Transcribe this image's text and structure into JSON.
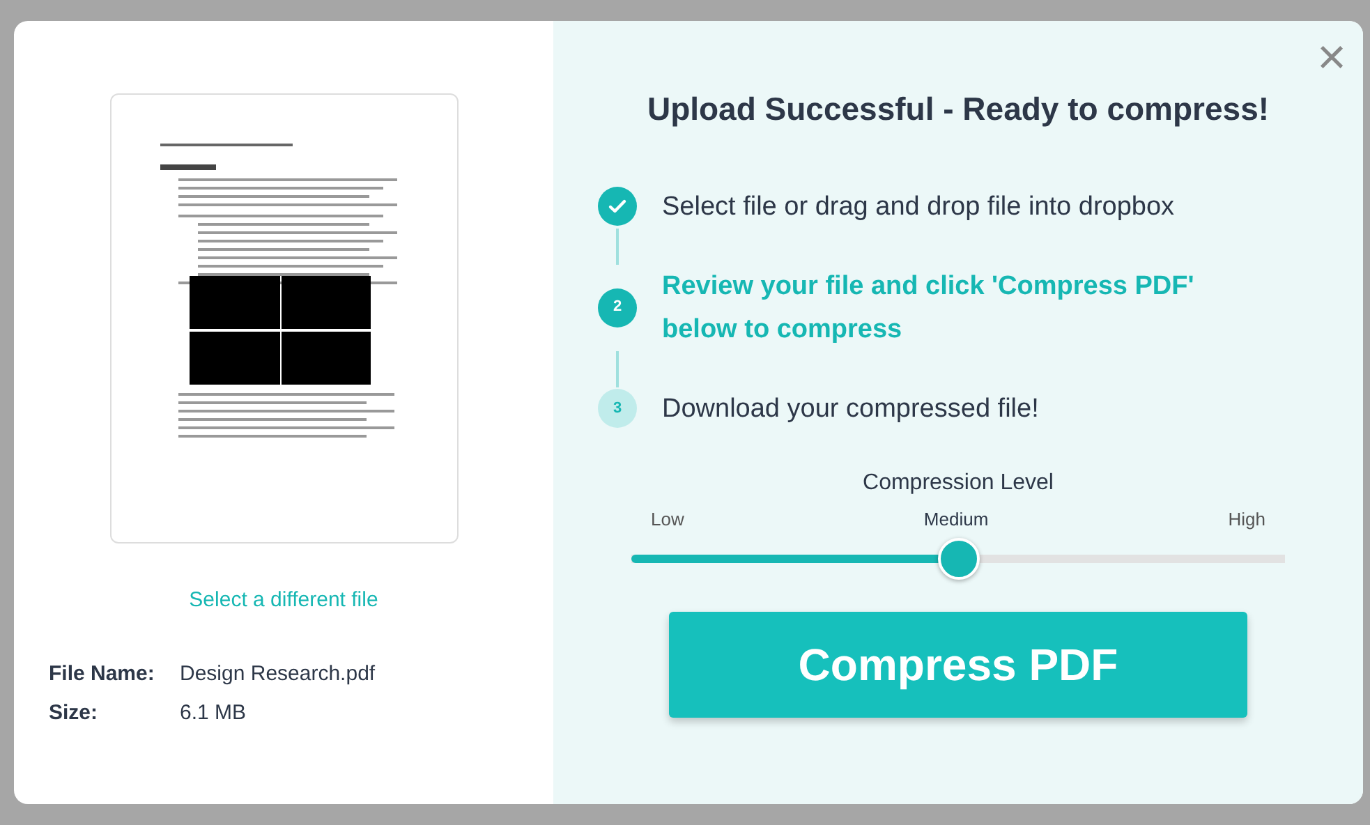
{
  "preview": {
    "kind": "picture",
    "link": "Select a different file"
  },
  "file_info": [
    {
      "label": "File Name:",
      "value": "Design Research.pdf"
    },
    {
      "label": "Size:",
      "value": "6.1 MB"
    }
  ],
  "heading": "Upload Successful - Ready to compress!",
  "steps": [
    {
      "kind": "done",
      "text": "Select file or drag and drop file into dropbox"
    },
    {
      "kind": "active",
      "number": "2",
      "text": "Review your file and click 'Compress PDF' below to compress"
    },
    {
      "kind": "pending",
      "number": "3",
      "text": "Download your compressed file!"
    }
  ],
  "compression": {
    "title": "Compression Level",
    "options": [
      {
        "label": "Low",
        "selected": false
      },
      {
        "label": "Medium",
        "selected": true
      },
      {
        "label": "High",
        "selected": false
      }
    ],
    "level": 0.5
  },
  "button": "Compress PDF",
  "close": "×"
}
